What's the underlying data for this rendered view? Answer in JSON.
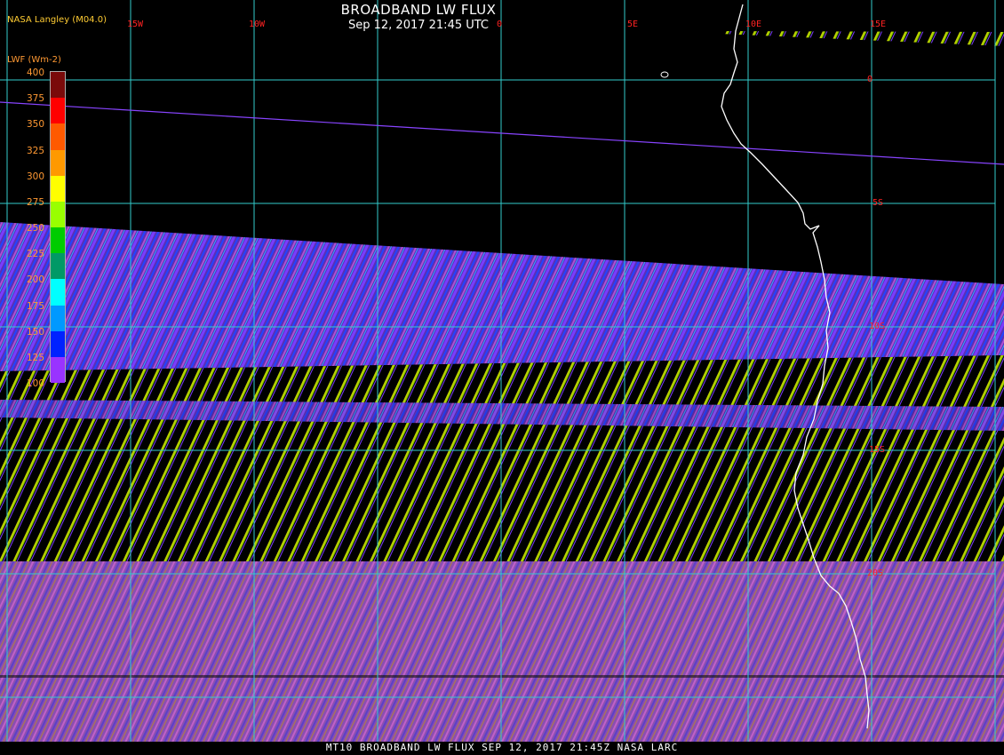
{
  "header": {
    "title": "BROADBAND LW FLUX",
    "subtitle": "Sep 12, 2017 21:45 UTC",
    "source": "NASA Langley (M04.0)",
    "units": "LWF (Wm-2)"
  },
  "longitude_labels": [
    "15W",
    "10W",
    "0",
    "5E",
    "10E",
    "15E"
  ],
  "latitude_labels": [
    "0",
    "5S",
    "10S",
    "15S",
    "20S"
  ],
  "legend": {
    "ticks": [
      "400",
      "375",
      "350",
      "325",
      "300",
      "275",
      "250",
      "225",
      "200",
      "175",
      "150",
      "125",
      "100"
    ],
    "colors": [
      "#7a0a0a",
      "#ff0000",
      "#ff5a00",
      "#ff9900",
      "#ffff00",
      "#99ff00",
      "#00cc00",
      "#009966",
      "#00ffff",
      "#0099ff",
      "#0022ff",
      "#9933ff"
    ]
  },
  "colors": {
    "grid": "#33cccc",
    "coastline": "#ffffff",
    "tick_text": "#ff2222",
    "legend_text": "#ff9933",
    "satellite_track": "#8844ff"
  },
  "footer": {
    "text": "MT10  BROADBAND LW FLUX   SEP 12, 2017 21:45Z   NASA LARC"
  }
}
